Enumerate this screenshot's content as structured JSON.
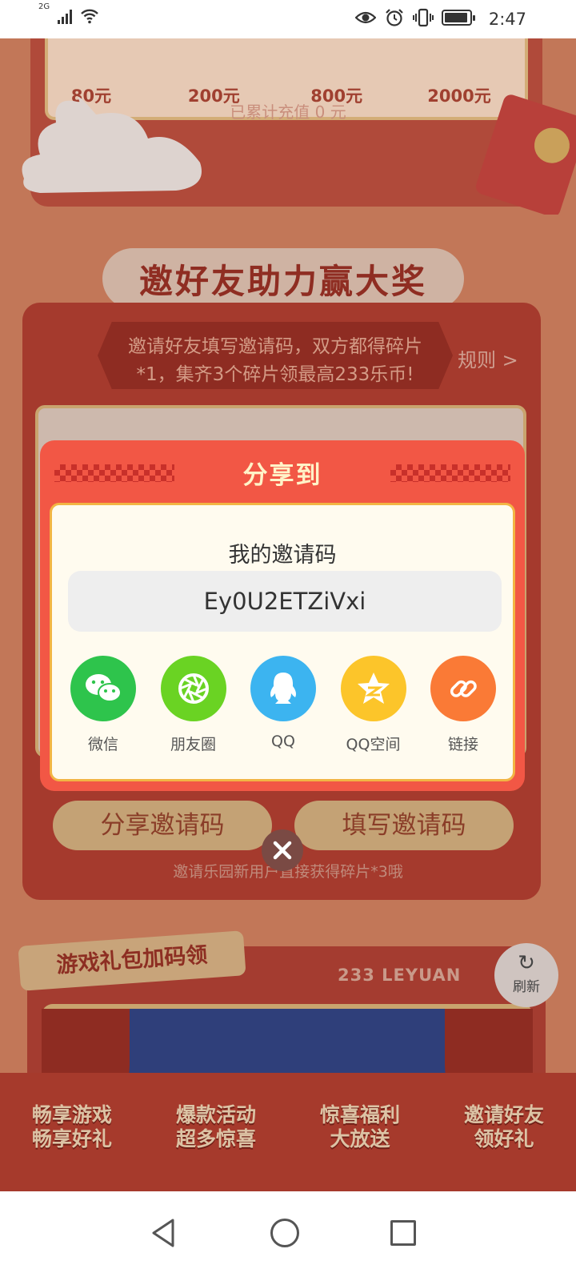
{
  "status_bar": {
    "network": "2G",
    "time": "2:47"
  },
  "background": {
    "recharge_amounts": [
      "80元",
      "200元",
      "800元",
      "2000元"
    ],
    "recharge_total": "已累计充值 0 元",
    "invite_title": "邀好友助力赢大奖",
    "rule_text": "邀请好友填写邀请码，双方都得碎片*1，集齐3个碎片领最高233乐币!",
    "rule_link": "规则 >",
    "share_code_button": "分享邀请码",
    "fill_code_button": "填写邀请码",
    "invite_hint": "邀请乐园新用户直接获得碎片*3哦",
    "gift_tag": "游戏礼包加码领",
    "brand": "233 LEYUAN",
    "refresh": "刷新",
    "features": [
      {
        "line1": "畅享游戏",
        "line2": "畅享好礼"
      },
      {
        "line1": "爆款活动",
        "line2": "超多惊喜"
      },
      {
        "line1": "惊喜福利",
        "line2": "大放送"
      },
      {
        "line1": "邀请好友",
        "line2": "领好礼"
      }
    ]
  },
  "share_modal": {
    "title": "分享到",
    "code_label": "我的邀请码",
    "code_value": "Ey0U2ETZiVxi",
    "options": [
      {
        "label": "微信",
        "icon": "wechat-icon",
        "color": "#2ec44c"
      },
      {
        "label": "朋友圈",
        "icon": "moments-icon",
        "color": "#6ad323"
      },
      {
        "label": "QQ",
        "icon": "qq-icon",
        "color": "#3cb4f0"
      },
      {
        "label": "QQ空间",
        "icon": "qzone-icon",
        "color": "#fcc52a"
      },
      {
        "label": "链接",
        "icon": "link-icon",
        "color": "#fa7a36"
      }
    ]
  },
  "colors": {
    "modal_red": "#f25745",
    "modal_gold": "#f2b544",
    "modal_cream": "#fffbef"
  }
}
